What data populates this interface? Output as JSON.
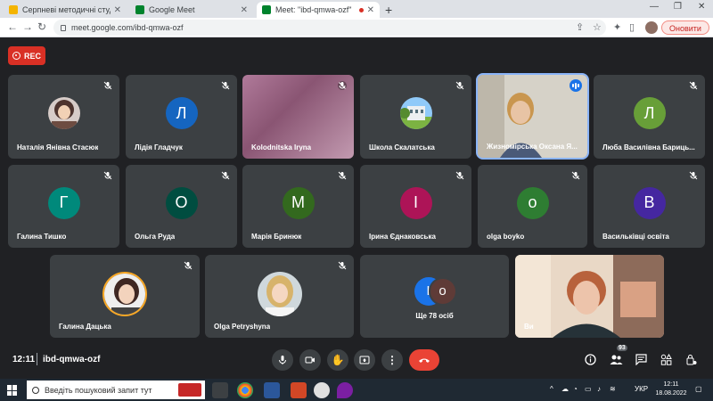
{
  "browser": {
    "tabs": [
      {
        "label": "Серпневі методичні студії з укр",
        "active": false,
        "favicon_color": "#f4b400"
      },
      {
        "label": "Google Meet",
        "active": false,
        "favicon_color": "#00832d"
      },
      {
        "label": "Meet: \"ibd-qmwa-ozf\"",
        "active": true,
        "favicon_color": "#00832d"
      }
    ],
    "new_tab": "+",
    "url": "meet.google.com/ibd-qmwa-ozf",
    "update_label": "Оновити"
  },
  "recording": {
    "label": "REC"
  },
  "participants": [
    {
      "name": "Наталія Янівна Стасюк",
      "type": "photo",
      "muted": true
    },
    {
      "name": "Лідія Гладчук",
      "type": "initial",
      "initial": "Л",
      "color": "#1565c0",
      "muted": true
    },
    {
      "name": "Kolodnitska Iryna",
      "type": "video",
      "muted": true
    },
    {
      "name": "Школа Скалатська",
      "type": "photo",
      "muted": true
    },
    {
      "name": "Жизномірська Оксана Я...",
      "type": "video",
      "speaking": true,
      "muted": false
    },
    {
      "name": "Люба Василівна Бариць...",
      "type": "initial",
      "initial": "Л",
      "color": "#689f38",
      "muted": true
    },
    {
      "name": "Галина Тишко",
      "type": "initial",
      "initial": "Г",
      "color": "#00897b",
      "muted": true
    },
    {
      "name": "Ольга Руда",
      "type": "initial",
      "initial": "О",
      "color": "#004d40",
      "muted": true
    },
    {
      "name": "Марія Бринюк",
      "type": "initial",
      "initial": "М",
      "color": "#33691e",
      "muted": true
    },
    {
      "name": "Ірина Єднаковська",
      "type": "initial",
      "initial": "І",
      "color": "#ad1457",
      "muted": true
    },
    {
      "name": "olga boyko",
      "type": "initial",
      "initial": "o",
      "color": "#2e7d32",
      "muted": true
    },
    {
      "name": "Васильківці освіта",
      "type": "initial",
      "initial": "В",
      "color": "#4527a0",
      "muted": true
    },
    {
      "name": "Галина Дацька",
      "type": "photo",
      "muted": true
    },
    {
      "name": "Olga Petryshyna",
      "type": "photo",
      "muted": true
    },
    {
      "name": "Ви",
      "type": "video",
      "self": true,
      "muted": false
    }
  ],
  "more": {
    "label": "Ще 78 осіб",
    "initials": [
      "І",
      "о"
    ]
  },
  "meeting": {
    "time": "12:11",
    "code": "ibd-qmwa-ozf",
    "participant_count": "93"
  },
  "controls": [
    "mic-icon",
    "camera-icon",
    "raise-hand-icon",
    "present-icon",
    "more-options-icon",
    "end-call-icon"
  ],
  "right_controls": [
    "info-icon",
    "people-icon",
    "chat-icon",
    "activities-icon",
    "host-controls-icon"
  ],
  "taskbar": {
    "search_placeholder": "Введіть пошуковий запит тут",
    "language": "УКР",
    "time": "12:11",
    "date": "18.08.2022"
  }
}
